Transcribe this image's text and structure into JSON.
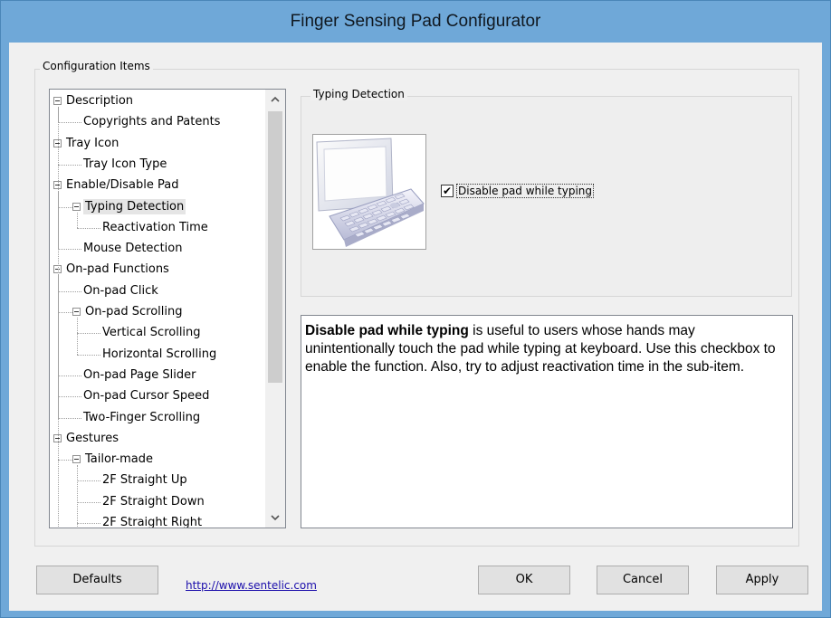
{
  "window": {
    "title": "Finger Sensing Pad Configurator"
  },
  "config_group": {
    "label": "Configuration Items"
  },
  "tree": {
    "items": [
      {
        "label": "Description",
        "level": 0
      },
      {
        "label": "Copyrights and Patents",
        "level": 1
      },
      {
        "label": "Tray Icon",
        "level": 0
      },
      {
        "label": "Tray Icon Type",
        "level": 1
      },
      {
        "label": "Enable/Disable Pad",
        "level": 0
      },
      {
        "label": "Typing Detection",
        "level": 1,
        "selected": true
      },
      {
        "label": "Reactivation Time",
        "level": 2
      },
      {
        "label": "Mouse Detection",
        "level": 1
      },
      {
        "label": "On-pad Functions",
        "level": 0
      },
      {
        "label": "On-pad Click",
        "level": 1
      },
      {
        "label": "On-pad Scrolling",
        "level": 1
      },
      {
        "label": "Vertical Scrolling",
        "level": 2
      },
      {
        "label": "Horizontal Scrolling",
        "level": 2
      },
      {
        "label": "On-pad Page Slider",
        "level": 1
      },
      {
        "label": "On-pad Cursor Speed",
        "level": 1
      },
      {
        "label": "Two-Finger Scrolling",
        "level": 1
      },
      {
        "label": "Gestures",
        "level": 0
      },
      {
        "label": "Tailor-made",
        "level": 1
      },
      {
        "label": "2F Straight Up",
        "level": 2
      },
      {
        "label": "2F Straight Down",
        "level": 2
      },
      {
        "label": "2F Straight Right",
        "level": 2
      }
    ]
  },
  "typing_detection": {
    "label": "Typing Detection",
    "checkbox_label": "Disable pad while typing",
    "checked": true
  },
  "description": {
    "bold": "Disable pad while typing",
    "text": " is useful to users whose hands may unintentionally touch the pad while typing at keyboard. Use this checkbox to enable the function. Also, try to adjust reactivation time in the sub-item."
  },
  "footer": {
    "defaults_label": "Defaults",
    "link": "http://www.sentelic.com",
    "ok_label": "OK",
    "cancel_label": "Cancel",
    "apply_label": "Apply"
  },
  "icons": {
    "scroll_up": "chevron-up-icon",
    "scroll_down": "chevron-down-icon",
    "check": "✔",
    "up_glyph": "︿",
    "down_glyph": "﹀"
  },
  "colors": {
    "titlebar": "#6fa8d8",
    "selection": "#e5e5e5"
  }
}
